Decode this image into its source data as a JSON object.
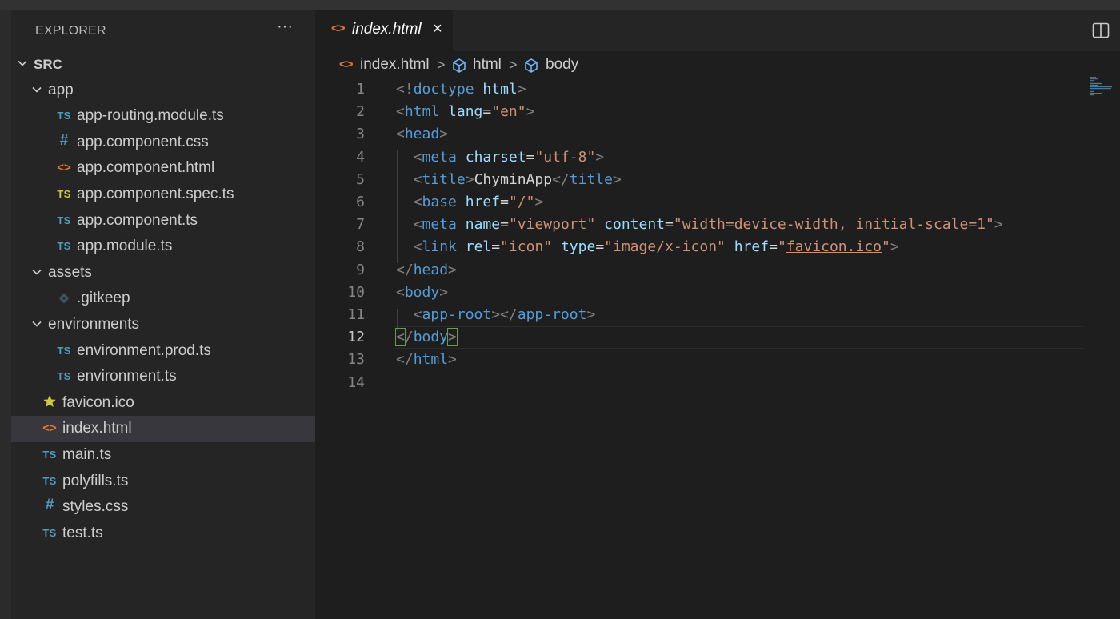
{
  "sidebar": {
    "title": "EXPLORER",
    "more_label": "···",
    "tree": [
      {
        "label": "SRC",
        "kind": "folder",
        "bold": true,
        "expanded": true,
        "depth": 0
      },
      {
        "label": "app",
        "kind": "folder",
        "expanded": true,
        "depth": 1
      },
      {
        "label": "app-routing.module.ts",
        "kind": "ts",
        "icon_text": "TS",
        "depth": 2
      },
      {
        "label": "app.component.css",
        "kind": "css",
        "icon_text": "#",
        "depth": 2
      },
      {
        "label": "app.component.html",
        "kind": "html",
        "icon_text": "<>",
        "depth": 2
      },
      {
        "label": "app.component.spec.ts",
        "kind": "ts-spec",
        "icon_text": "TS",
        "depth": 2
      },
      {
        "label": "app.component.ts",
        "kind": "ts",
        "icon_text": "TS",
        "depth": 2
      },
      {
        "label": "app.module.ts",
        "kind": "ts",
        "icon_text": "TS",
        "depth": 2
      },
      {
        "label": "assets",
        "kind": "folder",
        "expanded": true,
        "depth": 1
      },
      {
        "label": ".gitkeep",
        "kind": "git",
        "depth": 2
      },
      {
        "label": "environments",
        "kind": "folder",
        "expanded": true,
        "depth": 1
      },
      {
        "label": "environment.prod.ts",
        "kind": "ts",
        "icon_text": "TS",
        "depth": 2
      },
      {
        "label": "environment.ts",
        "kind": "ts",
        "icon_text": "TS",
        "depth": 2
      },
      {
        "label": "favicon.ico",
        "kind": "star",
        "depth": 1
      },
      {
        "label": "index.html",
        "kind": "html",
        "icon_text": "<>",
        "depth": 1,
        "selected": true
      },
      {
        "label": "main.ts",
        "kind": "ts",
        "icon_text": "TS",
        "depth": 1
      },
      {
        "label": "polyfills.ts",
        "kind": "ts",
        "icon_text": "TS",
        "depth": 1
      },
      {
        "label": "styles.css",
        "kind": "css",
        "icon_text": "#",
        "depth": 1
      },
      {
        "label": "test.ts",
        "kind": "ts",
        "icon_text": "TS",
        "depth": 1
      }
    ]
  },
  "tab": {
    "label": "index.html",
    "icon_text": "<>",
    "close_label": "×"
  },
  "breadcrumb": {
    "file": "index.html",
    "icon_text": "<>",
    "sep": ">",
    "items": [
      "html",
      "body"
    ]
  },
  "editor": {
    "active_line": 12,
    "lines": [
      [
        [
          "pu",
          "<!"
        ],
        [
          "tg",
          "doctype"
        ],
        [
          "tx",
          " "
        ],
        [
          "at",
          "html"
        ],
        [
          "pu",
          ">"
        ]
      ],
      [
        [
          "pu",
          "<"
        ],
        [
          "tg",
          "html"
        ],
        [
          "tx",
          " "
        ],
        [
          "at",
          "lang"
        ],
        [
          "tx",
          "="
        ],
        [
          "st",
          "\"en\""
        ],
        [
          "pu",
          ">"
        ]
      ],
      [
        [
          "pu",
          "<"
        ],
        [
          "tg",
          "head"
        ],
        [
          "pu",
          ">"
        ]
      ],
      [
        [
          "tx",
          "  "
        ],
        [
          "pu",
          "<"
        ],
        [
          "tg",
          "meta"
        ],
        [
          "tx",
          " "
        ],
        [
          "at",
          "charset"
        ],
        [
          "tx",
          "="
        ],
        [
          "st",
          "\"utf-8\""
        ],
        [
          "pu",
          ">"
        ]
      ],
      [
        [
          "tx",
          "  "
        ],
        [
          "pu",
          "<"
        ],
        [
          "tg",
          "title"
        ],
        [
          "pu",
          ">"
        ],
        [
          "tx",
          "ChyminApp"
        ],
        [
          "pu",
          "</"
        ],
        [
          "tg",
          "title"
        ],
        [
          "pu",
          ">"
        ]
      ],
      [
        [
          "tx",
          "  "
        ],
        [
          "pu",
          "<"
        ],
        [
          "tg",
          "base"
        ],
        [
          "tx",
          " "
        ],
        [
          "at",
          "href"
        ],
        [
          "tx",
          "="
        ],
        [
          "st",
          "\"/\""
        ],
        [
          "pu",
          ">"
        ]
      ],
      [
        [
          "tx",
          "  "
        ],
        [
          "pu",
          "<"
        ],
        [
          "tg",
          "meta"
        ],
        [
          "tx",
          " "
        ],
        [
          "at",
          "name"
        ],
        [
          "tx",
          "="
        ],
        [
          "st",
          "\"viewport\""
        ],
        [
          "tx",
          " "
        ],
        [
          "at",
          "content"
        ],
        [
          "tx",
          "="
        ],
        [
          "st",
          "\"width=device-width, initial-scale=1\""
        ],
        [
          "pu",
          ">"
        ]
      ],
      [
        [
          "tx",
          "  "
        ],
        [
          "pu",
          "<"
        ],
        [
          "tg",
          "link"
        ],
        [
          "tx",
          " "
        ],
        [
          "at",
          "rel"
        ],
        [
          "tx",
          "="
        ],
        [
          "st",
          "\"icon\""
        ],
        [
          "tx",
          " "
        ],
        [
          "at",
          "type"
        ],
        [
          "tx",
          "="
        ],
        [
          "st",
          "\"image/x-icon\""
        ],
        [
          "tx",
          " "
        ],
        [
          "at",
          "href"
        ],
        [
          "tx",
          "="
        ],
        [
          "st",
          "\""
        ],
        [
          "stu",
          "favicon.ico"
        ],
        [
          "st",
          "\""
        ],
        [
          "pu",
          ">"
        ]
      ],
      [
        [
          "pu",
          "</"
        ],
        [
          "tg",
          "head"
        ],
        [
          "pu",
          ">"
        ]
      ],
      [
        [
          "pu",
          "<"
        ],
        [
          "tg",
          "body"
        ],
        [
          "pu",
          ">"
        ]
      ],
      [
        [
          "tx",
          "  "
        ],
        [
          "pu",
          "<"
        ],
        [
          "tg",
          "app-root"
        ],
        [
          "pu",
          "></"
        ],
        [
          "tg",
          "app-root"
        ],
        [
          "pu",
          ">"
        ]
      ],
      [
        [
          "pub",
          "<"
        ],
        [
          "pu",
          "/"
        ],
        [
          "tg",
          "body"
        ],
        [
          "pub",
          ">"
        ]
      ],
      [
        [
          "pu",
          "</"
        ],
        [
          "tg",
          "html"
        ],
        [
          "pu",
          ">"
        ]
      ],
      []
    ]
  },
  "colors": {
    "ts": "#519aba",
    "ts_spec": "#cbcb41",
    "html": "#e37933",
    "star": "#cbcb41",
    "selection": "#37373d"
  }
}
